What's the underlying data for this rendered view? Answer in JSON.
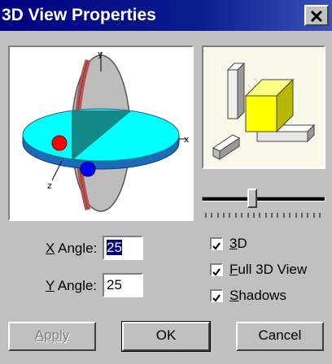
{
  "window": {
    "title": "3D View Properties"
  },
  "close_glyph": "✕",
  "x_angle": {
    "label_mnemonic": "X",
    "label_rest": " Angle:",
    "value": "25"
  },
  "y_angle": {
    "label_mnemonic": "Y",
    "label_rest": " Angle:",
    "value": "25"
  },
  "axes": {
    "x": "x",
    "y": "y",
    "z": "z"
  },
  "options": [
    {
      "mnemonic": "3",
      "rest": "D",
      "checked": true
    },
    {
      "mnemonic": "F",
      "rest": "ull 3D View",
      "checked": true
    },
    {
      "mnemonic": "S",
      "rest": "hadows",
      "checked": true
    }
  ],
  "slider": {
    "ticks": 20
  },
  "buttons": {
    "apply": "Apply",
    "ok": "OK",
    "cancel": "Cancel"
  },
  "colors": {
    "title_bar": "#000080",
    "dialog": "#c0c0c0",
    "preview_bg": "#ffff9c",
    "disc": "#00ffff",
    "disc_edge": "#1c6bb8",
    "ring_red": "#c0504d",
    "marker_red": "#ff0000",
    "marker_blue": "#0000ff",
    "box_yellow": "#ffff00"
  }
}
